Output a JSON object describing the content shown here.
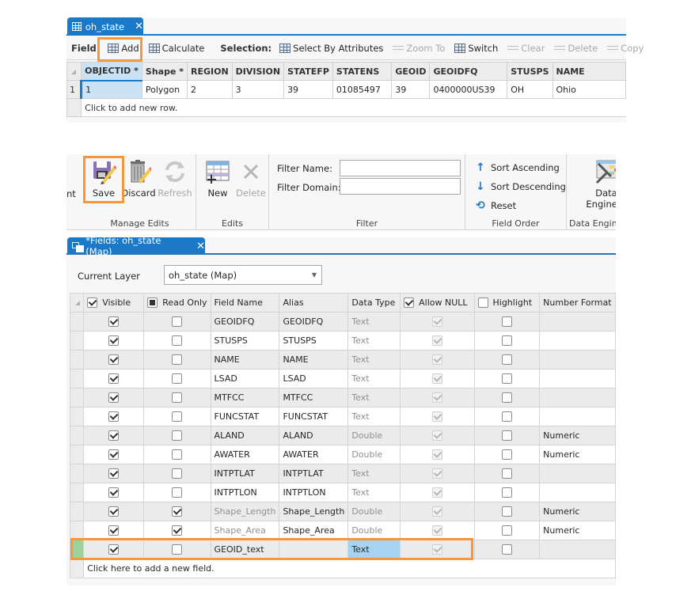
{
  "table_view": {
    "tab": {
      "label": "oh_state",
      "icon": "table-icon",
      "close": "✕"
    },
    "toolbar": {
      "field_label": "Field:",
      "add": "Add",
      "calculate": "Calculate",
      "selection_label": "Selection:",
      "select_by_attributes": "Select By Attributes",
      "zoom_to": "Zoom To",
      "switch": "Switch",
      "clear": "Clear",
      "delete": "Delete",
      "copy": "Copy"
    },
    "columns": [
      "OBJECTID *",
      "Shape *",
      "REGION",
      "DIVISION",
      "STATEFP",
      "STATENS",
      "GEOID",
      "GEOIDFQ",
      "STUSPS",
      "NAME"
    ],
    "rows": [
      {
        "row_num": "1",
        "cells": [
          "1",
          "Polygon",
          "2",
          "3",
          "39",
          "01085497",
          "39",
          "0400000US39",
          "OH",
          "Ohio"
        ]
      }
    ],
    "add_row_text": "Click to add new row."
  },
  "ribbon": {
    "clipped_left_label": "nt",
    "manage_edits": {
      "label": "Manage Edits",
      "save": "Save",
      "discard": "Discard",
      "refresh": "Refresh"
    },
    "edits": {
      "label": "Edits",
      "new": "New",
      "delete": "Delete"
    },
    "filter": {
      "label": "Filter",
      "filter_name_label": "Filter Name:",
      "filter_name_value": "",
      "filter_domain_label": "Filter Domain:",
      "filter_domain_value": ""
    },
    "field_order": {
      "label": "Field Order",
      "sort_ascending": "Sort Ascending",
      "sort_descending": "Sort Descending",
      "reset": "Reset"
    },
    "data_engineering": {
      "label": "Data Engin",
      "button_line1": "Data",
      "button_line2": "Engineer"
    }
  },
  "fields_view": {
    "tab": {
      "label": "*Fields: oh_state (Map)",
      "icon": "fields-icon",
      "close": "✕"
    },
    "current_layer_label": "Current Layer",
    "current_layer_value": "oh_state (Map)",
    "columns": {
      "visible": "Visible",
      "read_only": "Read Only",
      "field_name": "Field Name",
      "alias": "Alias",
      "data_type": "Data Type",
      "allow_null": "Allow NULL",
      "highlight": "Highlight",
      "number_format": "Number Format"
    },
    "header_checks": {
      "visible": true,
      "read_only": "partial",
      "allow_null": true,
      "highlight": false
    },
    "rows": [
      {
        "visible": true,
        "read_only": false,
        "field_name": "GEOIDFQ",
        "alias": "GEOIDFQ",
        "data_type": "Text",
        "allow_null": true,
        "highlight": false,
        "number_format": ""
      },
      {
        "visible": true,
        "read_only": false,
        "field_name": "STUSPS",
        "alias": "STUSPS",
        "data_type": "Text",
        "allow_null": true,
        "highlight": false,
        "number_format": ""
      },
      {
        "visible": true,
        "read_only": false,
        "field_name": "NAME",
        "alias": "NAME",
        "data_type": "Text",
        "allow_null": true,
        "highlight": false,
        "number_format": ""
      },
      {
        "visible": true,
        "read_only": false,
        "field_name": "LSAD",
        "alias": "LSAD",
        "data_type": "Text",
        "allow_null": true,
        "highlight": false,
        "number_format": ""
      },
      {
        "visible": true,
        "read_only": false,
        "field_name": "MTFCC",
        "alias": "MTFCC",
        "data_type": "Text",
        "allow_null": true,
        "highlight": false,
        "number_format": ""
      },
      {
        "visible": true,
        "read_only": false,
        "field_name": "FUNCSTAT",
        "alias": "FUNCSTAT",
        "data_type": "Text",
        "allow_null": true,
        "highlight": false,
        "number_format": ""
      },
      {
        "visible": true,
        "read_only": false,
        "field_name": "ALAND",
        "alias": "ALAND",
        "data_type": "Double",
        "allow_null": true,
        "highlight": false,
        "number_format": "Numeric"
      },
      {
        "visible": true,
        "read_only": false,
        "field_name": "AWATER",
        "alias": "AWATER",
        "data_type": "Double",
        "allow_null": true,
        "highlight": false,
        "number_format": "Numeric"
      },
      {
        "visible": true,
        "read_only": false,
        "field_name": "INTPTLAT",
        "alias": "INTPTLAT",
        "data_type": "Text",
        "allow_null": true,
        "highlight": false,
        "number_format": ""
      },
      {
        "visible": true,
        "read_only": false,
        "field_name": "INTPTLON",
        "alias": "INTPTLON",
        "data_type": "Text",
        "allow_null": true,
        "highlight": false,
        "number_format": ""
      },
      {
        "visible": true,
        "read_only": true,
        "field_name": "Shape_Length",
        "alias": "Shape_Length",
        "data_type": "Double",
        "allow_null": true,
        "highlight": false,
        "number_format": "Numeric"
      },
      {
        "visible": true,
        "read_only": true,
        "field_name": "Shape_Area",
        "alias": "Shape_Area",
        "data_type": "Double",
        "allow_null": true,
        "highlight": false,
        "number_format": "Numeric"
      },
      {
        "visible": true,
        "read_only": false,
        "field_name": "GEOID_text",
        "alias": "",
        "data_type": "Text",
        "allow_null": true,
        "highlight": false,
        "number_format": "",
        "is_new": true
      }
    ],
    "add_field_text": "Click here to add a new field."
  },
  "colors": {
    "accent_blue": "#1b79c7",
    "highlight_orange": "#f7963b",
    "selected_cell": "#a7d3f2",
    "new_row_marker": "#9fd19f"
  }
}
